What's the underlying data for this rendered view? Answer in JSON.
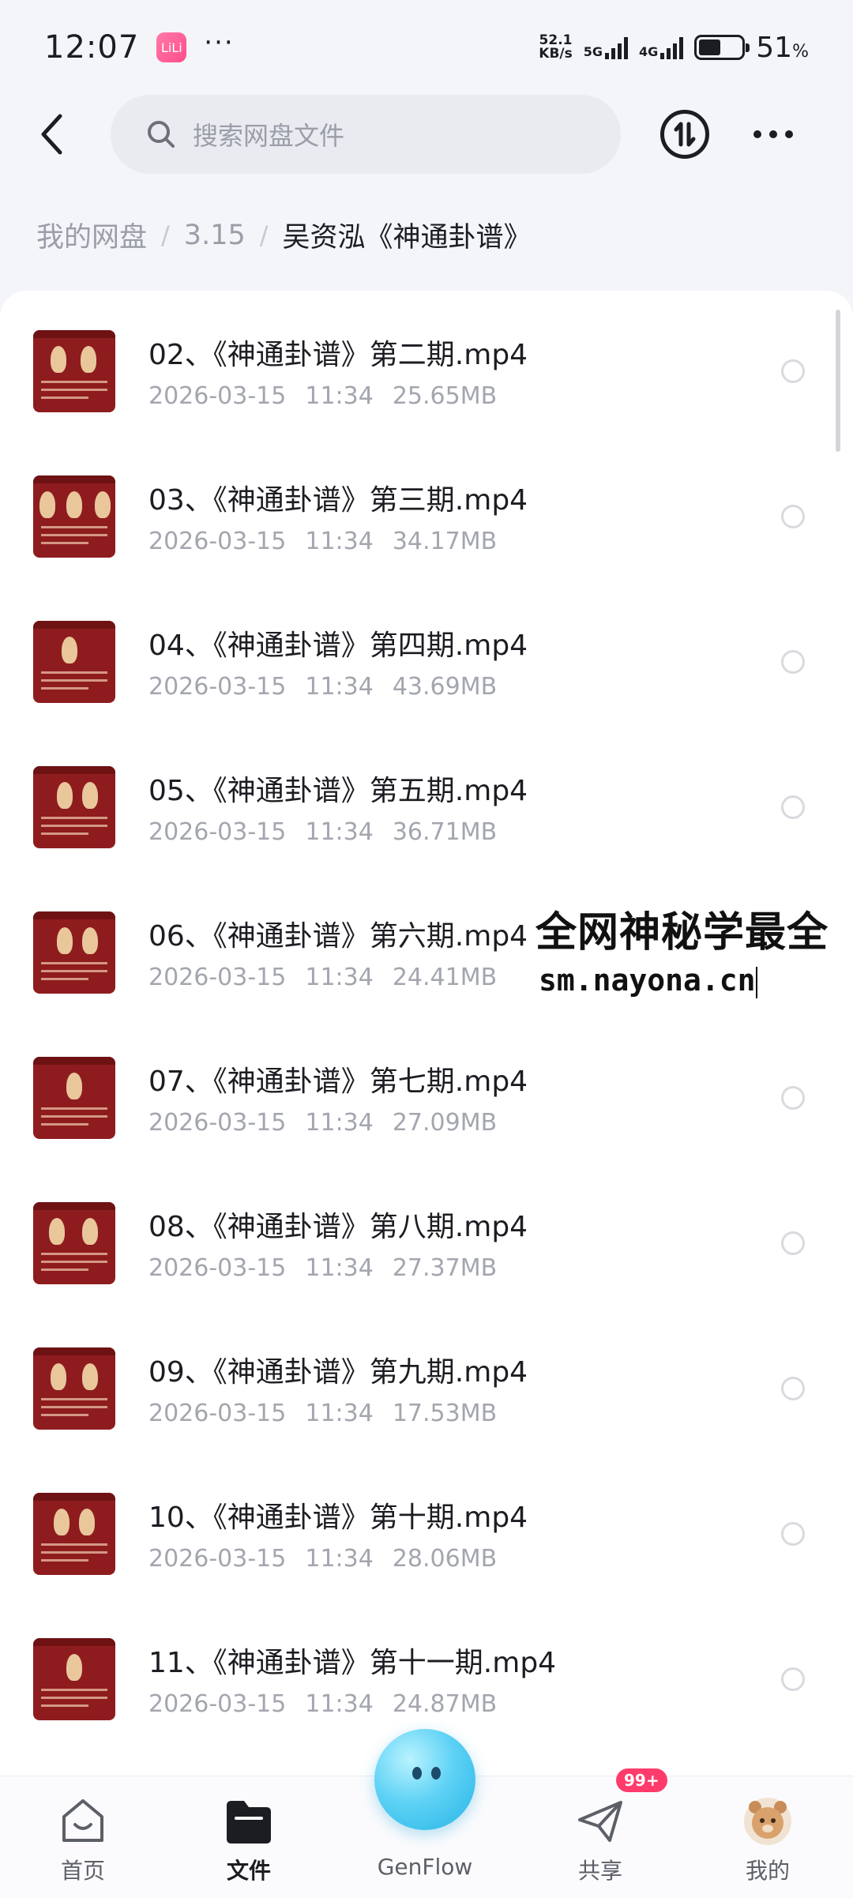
{
  "status_bar": {
    "time": "12:07",
    "app_badge": "LiLi",
    "more": "···",
    "net_speed_value": "52.1",
    "net_speed_unit": "KB/s",
    "sim1": "5G",
    "sim2": "4G",
    "battery_percent": "51",
    "battery_unit": "%",
    "battery_level": 0.51
  },
  "header": {
    "search_placeholder": "搜索网盘文件",
    "back_icon": "chevron-left-icon",
    "transfer_icon": "transfer-icon",
    "more_icon": "more-dots-icon"
  },
  "breadcrumb": {
    "items": [
      "我的网盘",
      "3.15"
    ],
    "separator": "/",
    "current": "吴资泓《神通卦谱》"
  },
  "files": [
    {
      "name": "02、《神通卦谱》第二期.mp4",
      "date": "2026-03-15",
      "time": "11:34",
      "size": "25.65MB"
    },
    {
      "name": "03、《神通卦谱》第三期.mp4",
      "date": "2026-03-15",
      "time": "11:34",
      "size": "34.17MB"
    },
    {
      "name": "04、《神通卦谱》第四期.mp4",
      "date": "2026-03-15",
      "time": "11:34",
      "size": "43.69MB"
    },
    {
      "name": "05、《神通卦谱》第五期.mp4",
      "date": "2026-03-15",
      "time": "11:34",
      "size": "36.71MB"
    },
    {
      "name": "06、《神通卦谱》第六期.mp4",
      "date": "2026-03-15",
      "time": "11:34",
      "size": "24.41MB"
    },
    {
      "name": "07、《神通卦谱》第七期.mp4",
      "date": "2026-03-15",
      "time": "11:34",
      "size": "27.09MB"
    },
    {
      "name": "08、《神通卦谱》第八期.mp4",
      "date": "2026-03-15",
      "time": "11:34",
      "size": "27.37MB"
    },
    {
      "name": "09、《神通卦谱》第九期.mp4",
      "date": "2026-03-15",
      "time": "11:34",
      "size": "17.53MB"
    },
    {
      "name": "10、《神通卦谱》第十期.mp4",
      "date": "2026-03-15",
      "time": "11:34",
      "size": "28.06MB"
    },
    {
      "name": "11、《神通卦谱》第十一期.mp4",
      "date": "2026-03-15",
      "time": "11:34",
      "size": "24.87MB"
    }
  ],
  "watermark": {
    "line1": "全网神秘学最全",
    "line2": "sm.nayona.cn"
  },
  "bottom_nav": {
    "items": [
      {
        "label": "首页",
        "icon": "home-icon"
      },
      {
        "label": "文件",
        "icon": "folder-icon",
        "active": true
      },
      {
        "label": "GenFlow",
        "icon": "genflow-mascot-icon"
      },
      {
        "label": "共享",
        "icon": "paper-plane-icon",
        "badge": "99+"
      },
      {
        "label": "我的",
        "icon": "avatar-icon"
      }
    ]
  },
  "colors": {
    "accent": "#1c1d22",
    "thumbnail": "#8e1c1e",
    "badge": "#ff3b6b",
    "muted_text": "#a3a6ae"
  }
}
